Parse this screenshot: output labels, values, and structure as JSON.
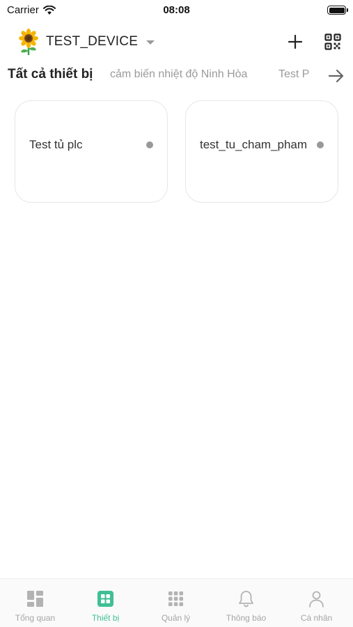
{
  "status_bar": {
    "carrier": "Carrier",
    "time": "08:08"
  },
  "header": {
    "home_name": "TEST_DEVICE",
    "icons": [
      "sunflower-icon",
      "caret-down-icon",
      "plus-icon",
      "qr-code-icon"
    ]
  },
  "tabs": [
    {
      "label": "Tất cả thiết bị",
      "active": true
    },
    {
      "label": "cảm biến nhiệt độ Ninh Hòa",
      "active": false
    },
    {
      "label": "Test P",
      "active": false
    }
  ],
  "devices": [
    {
      "name": "Test tủ plc",
      "status_color": "#999999"
    },
    {
      "name": "test_tu_cham_pham",
      "status_color": "#999999"
    }
  ],
  "bottom_nav": [
    {
      "label": "Tổng quan",
      "icon": "dashboard-icon",
      "active": false
    },
    {
      "label": "Thiết bị",
      "icon": "devices-grid-icon",
      "active": true
    },
    {
      "label": "Quản lý",
      "icon": "apps-grid-icon",
      "active": false
    },
    {
      "label": "Thông báo",
      "icon": "bell-icon",
      "active": false
    },
    {
      "label": "Cá nhân",
      "icon": "person-icon",
      "active": false
    }
  ],
  "colors": {
    "accent": "#3fbf94",
    "inactive": "#a5a5a5",
    "text_primary": "#222222"
  }
}
